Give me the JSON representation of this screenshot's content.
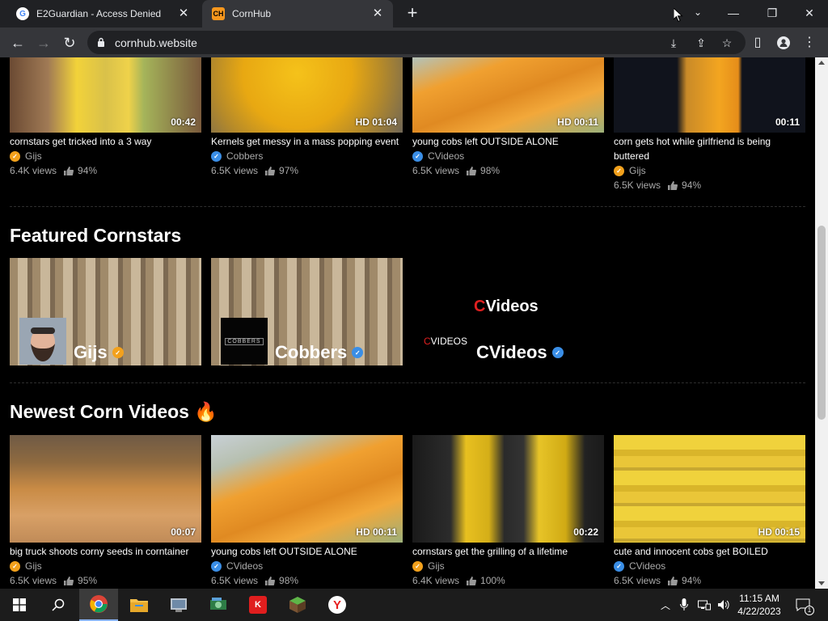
{
  "browser": {
    "tabs": [
      {
        "title": "E2Guardian - Access Denied",
        "favicon": "google-g-icon"
      },
      {
        "title": "CornHub",
        "favicon": "cornhub-logo-icon"
      }
    ],
    "url": "cornhub.website"
  },
  "top_videos": [
    {
      "title": "cornstars get tricked into a 3 way",
      "duration": "00:42",
      "channel": "Gijs",
      "verify": "gold",
      "views": "6.4K views",
      "rating": "94%"
    },
    {
      "title": "Kernels get messy in a mass popping event",
      "duration": "HD 01:04",
      "channel": "Cobbers",
      "verify": "blue",
      "views": "6.5K views",
      "rating": "97%"
    },
    {
      "title": "young cobs left OUTSIDE ALONE",
      "duration": "HD 00:11",
      "channel": "CVideos",
      "verify": "blue",
      "views": "6.5K views",
      "rating": "98%"
    },
    {
      "title": "corn gets hot while girlfriend is being buttered",
      "duration": "00:11",
      "channel": "Gijs",
      "verify": "gold",
      "views": "6.5K views",
      "rating": "94%"
    }
  ],
  "featured": {
    "heading": "Featured Cornstars",
    "stars": [
      {
        "name": "Gijs",
        "verify": "gold"
      },
      {
        "name": "Cobbers",
        "verify": "blue",
        "logo_text": "COBBERS"
      },
      {
        "name": "CVideos",
        "verify": "blue",
        "banner_c": "C",
        "banner_rest": "Videos",
        "logo_c": "C",
        "logo_rest": "VIDEOS"
      }
    ]
  },
  "newest": {
    "heading": "Newest Corn Videos",
    "emoji": "🔥",
    "videos": [
      {
        "title": "big truck shoots corny seeds in corntainer",
        "duration": "00:07",
        "channel": "Gijs",
        "verify": "gold",
        "views": "6.5K views",
        "rating": "95%"
      },
      {
        "title": "young cobs left OUTSIDE ALONE",
        "duration": "HD 00:11",
        "channel": "CVideos",
        "verify": "blue",
        "views": "6.5K views",
        "rating": "98%"
      },
      {
        "title": "cornstars get the grilling of a lifetime",
        "duration": "00:22",
        "channel": "Gijs",
        "verify": "gold",
        "views": "6.4K views",
        "rating": "100%"
      },
      {
        "title": "cute and innocent cobs get BOILED",
        "duration": "HD 00:15",
        "channel": "CVideos",
        "verify": "blue",
        "views": "6.5K views",
        "rating": "94%"
      }
    ]
  },
  "taskbar": {
    "time": "11:15 AM",
    "date": "4/22/2023",
    "notifications": "1",
    "ku_label": "K"
  },
  "colors": {
    "accent_red": "#e02020",
    "badge_gold": "#f3a11c",
    "badge_blue": "#3a8ee6"
  }
}
